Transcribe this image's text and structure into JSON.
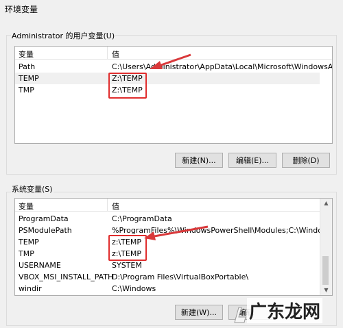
{
  "window": {
    "title": "环境变量"
  },
  "user_vars": {
    "group_label": "Administrator 的用户变量(U)",
    "col_name": "变量",
    "col_value": "值",
    "rows": [
      {
        "name": "Path",
        "value": "C:\\Users\\Administrator\\AppData\\Local\\Microsoft\\WindowsA..."
      },
      {
        "name": "TEMP",
        "value": "Z:\\TEMP"
      },
      {
        "name": "TMP",
        "value": "Z:\\TEMP"
      }
    ],
    "buttons": {
      "new": "新建(N)...",
      "edit": "编辑(E)...",
      "delete": "删除(D)"
    }
  },
  "system_vars": {
    "group_label": "系统变量(S)",
    "col_name": "变量",
    "col_value": "值",
    "rows": [
      {
        "name": "ProgramData",
        "value": "C:\\ProgramData"
      },
      {
        "name": "PSModulePath",
        "value": "%ProgramFiles%\\WindowsPowerShell\\Modules;C:\\Windows\\..."
      },
      {
        "name": "TEMP",
        "value": "z:\\TEMP"
      },
      {
        "name": "TMP",
        "value": "z:\\TEMP"
      },
      {
        "name": "USERNAME",
        "value": "SYSTEM"
      },
      {
        "name": "VBOX_MSI_INSTALL_PATH",
        "value": "D:\\Program Files\\VirtualBoxPortable\\"
      },
      {
        "name": "windir",
        "value": "C:\\Windows"
      }
    ],
    "buttons": {
      "new": "新建(W)...",
      "edit": "编辑"
    }
  },
  "watermark": {
    "text": "广东龙网"
  },
  "colors": {
    "highlight": "#e02d2d",
    "arrow": "#d9383a"
  }
}
